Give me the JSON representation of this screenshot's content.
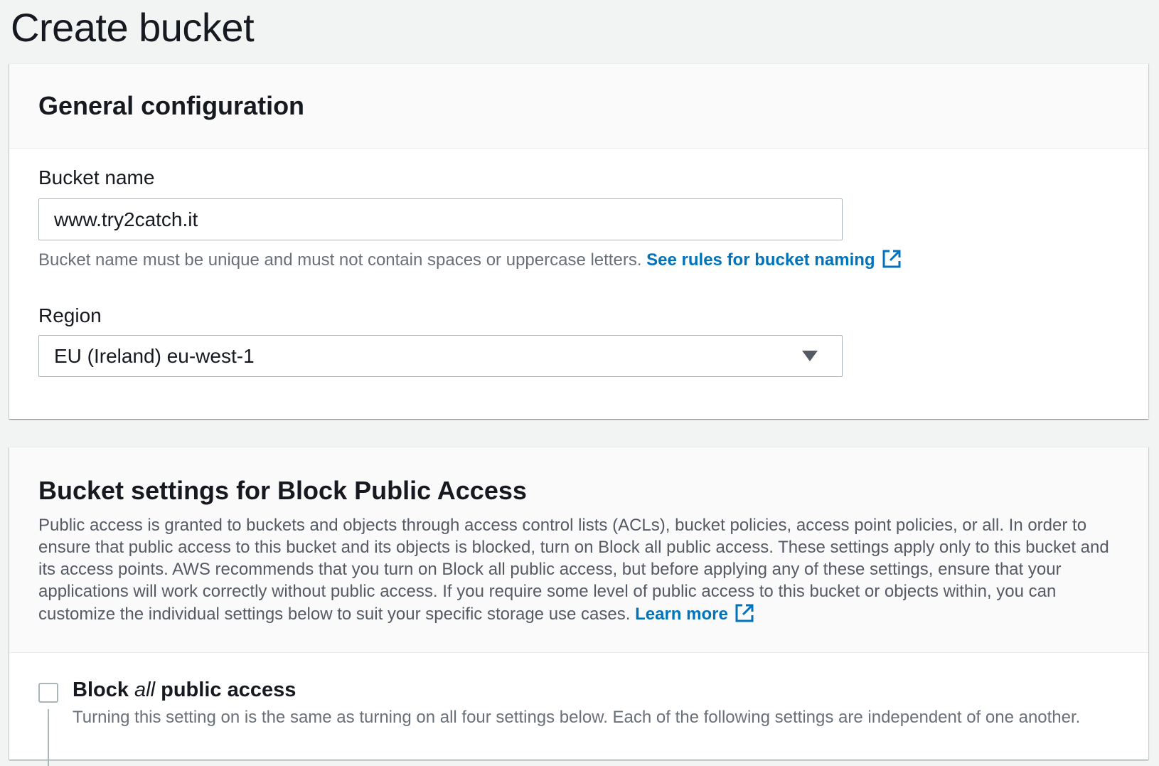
{
  "page": {
    "title": "Create bucket"
  },
  "general": {
    "heading": "General configuration",
    "bucket_name": {
      "label": "Bucket name",
      "value": "www.try2catch.it",
      "hint": "Bucket name must be unique and must not contain spaces or uppercase letters.",
      "rules_link": "See rules for bucket naming"
    },
    "region": {
      "label": "Region",
      "selected": "EU (Ireland) eu-west-1"
    }
  },
  "block_public_access": {
    "heading": "Bucket settings for Block Public Access",
    "description": "Public access is granted to buckets and objects through access control lists (ACLs), bucket policies, access point policies, or all. In order to ensure that public access to this bucket and its objects is blocked, turn on Block all public access. These settings apply only to this bucket and its access points. AWS recommends that you turn on Block all public access, but before applying any of these settings, ensure that your applications will work correctly without public access. If you require some level of public access to this bucket or objects within, you can customize the individual settings below to suit your specific storage use cases.",
    "learn_more": "Learn more",
    "block_all": {
      "label_prefix": "Block",
      "label_emphasis": "all",
      "label_suffix": "public access",
      "checked": false,
      "description": "Turning this setting on is the same as turning on all four settings below. Each of the following settings are independent of one another."
    }
  },
  "colors": {
    "link": "#0073bb",
    "background": "#f2f3f3",
    "border": "#aab7b8"
  },
  "icons": [
    "external-link-icon",
    "caret-down-icon"
  ]
}
